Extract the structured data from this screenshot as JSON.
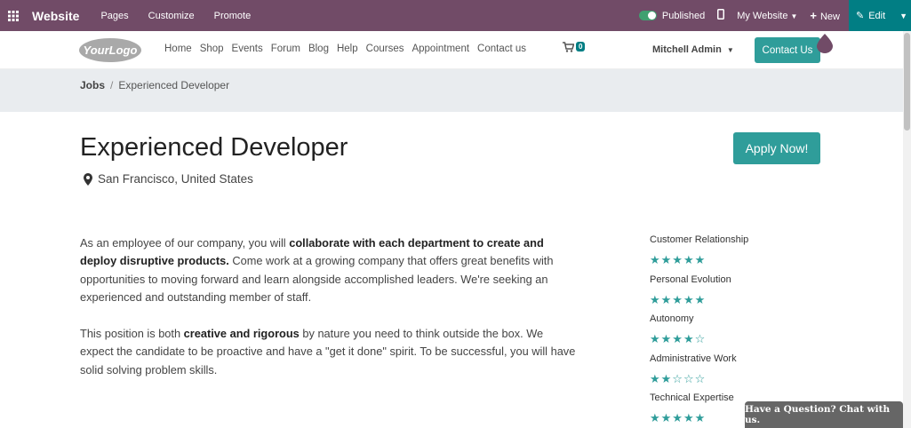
{
  "adminbar": {
    "brand": "Website",
    "menu": [
      "Pages",
      "Customize",
      "Promote"
    ],
    "published_label": "Published",
    "mywebsite_label": "My Website",
    "new_label": "New",
    "edit_label": "Edit",
    "color": "#714b67",
    "edit_color": "#017e84"
  },
  "sitenav": {
    "logo_text": "YourLogo",
    "links": [
      "Home",
      "Shop",
      "Events",
      "Forum",
      "Blog",
      "Help",
      "Courses",
      "Appointment",
      "Contact us"
    ],
    "cart_count": "0",
    "user": "Mitchell Admin",
    "contact_button": "Contact Us"
  },
  "breadcrumb": {
    "root": "Jobs",
    "separator": "/",
    "current": "Experienced Developer"
  },
  "job": {
    "title": "Experienced Developer",
    "location": "San Francisco, United States",
    "apply_label": "Apply Now!",
    "p1_a": "As an employee of our company, you will ",
    "p1_b": "collaborate with each department to create and deploy disruptive products.",
    "p1_c": " Come work at a growing company that offers great benefits with opportunities to moving forward and learn alongside accomplished leaders. We're seeking an experienced and outstanding member of staff.",
    "p2_a": "This position is both ",
    "p2_b": "creative and rigorous",
    "p2_c": " by nature you need to think outside the box. We expect the candidate to be proactive and have a \"get it done\" spirit. To be successful, you will have solid solving problem skills."
  },
  "ratings": [
    {
      "label": "Customer Relationship",
      "stars": "★★★★★",
      "score": 5
    },
    {
      "label": "Personal Evolution",
      "stars": "★★★★★",
      "score": 5
    },
    {
      "label": "Autonomy",
      "stars": "★★★★☆",
      "score": 4
    },
    {
      "label": "Administrative Work",
      "stars": "★★☆☆☆",
      "score": 2
    },
    {
      "label": "Technical Expertise",
      "stars": "★★★★★",
      "score": 5
    }
  ],
  "chat": {
    "label": "Have a Question? Chat with us."
  },
  "accent_color": "#2f9d9a"
}
